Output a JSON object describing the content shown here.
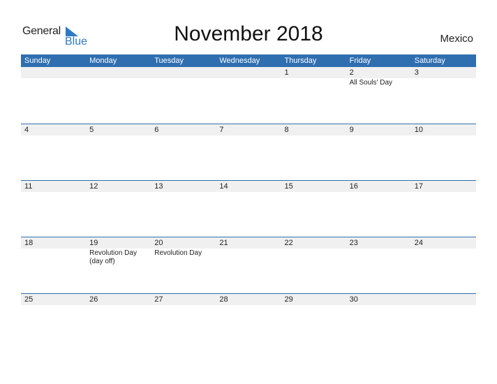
{
  "logo": {
    "line1": "General",
    "line2": "Blue"
  },
  "title": "November 2018",
  "country": "Mexico",
  "colors": {
    "header_bg": "#2f6fb0",
    "date_strip_bg": "#f0f0f0",
    "brand_blue": "#2f78c4"
  },
  "weekdays": [
    "Sunday",
    "Monday",
    "Tuesday",
    "Wednesday",
    "Thursday",
    "Friday",
    "Saturday"
  ],
  "weeks": [
    {
      "days": [
        "",
        "",
        "",
        "",
        "1",
        "2",
        "3"
      ],
      "events": [
        "",
        "",
        "",
        "",
        "",
        "All Souls' Day",
        ""
      ]
    },
    {
      "days": [
        "4",
        "5",
        "6",
        "7",
        "8",
        "9",
        "10"
      ],
      "events": [
        "",
        "",
        "",
        "",
        "",
        "",
        ""
      ]
    },
    {
      "days": [
        "11",
        "12",
        "13",
        "14",
        "15",
        "16",
        "17"
      ],
      "events": [
        "",
        "",
        "",
        "",
        "",
        "",
        ""
      ]
    },
    {
      "days": [
        "18",
        "19",
        "20",
        "21",
        "22",
        "23",
        "24"
      ],
      "events": [
        "",
        "Revolution Day (day off)",
        "Revolution Day",
        "",
        "",
        "",
        ""
      ]
    },
    {
      "days": [
        "25",
        "26",
        "27",
        "28",
        "29",
        "30",
        ""
      ],
      "events": [
        "",
        "",
        "",
        "",
        "",
        "",
        ""
      ]
    }
  ]
}
